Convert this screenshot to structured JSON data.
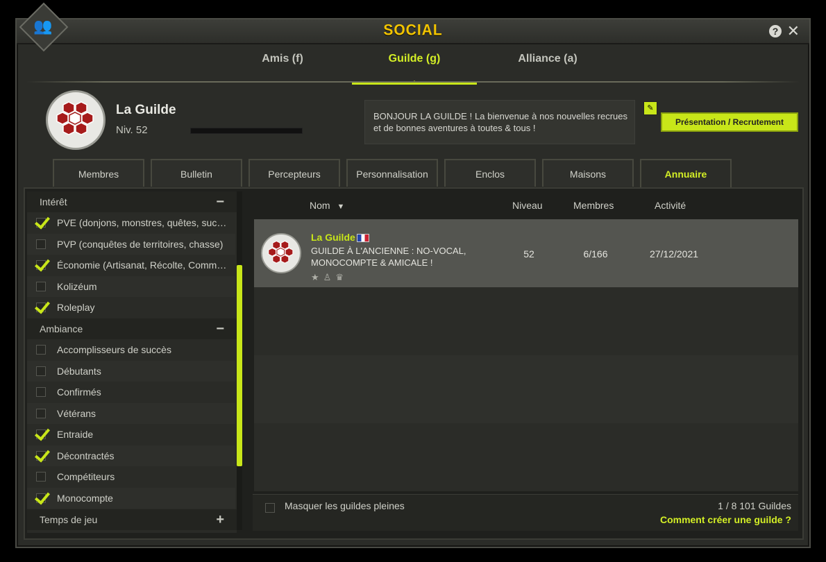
{
  "window": {
    "title": "SOCIAL"
  },
  "main_tabs": [
    {
      "label": "Amis (f)"
    },
    {
      "label": "Guilde (g)"
    },
    {
      "label": "Alliance (a)"
    }
  ],
  "guild": {
    "name": "La Guilde",
    "level": "Niv. 52",
    "motd": "BONJOUR LA GUILDE ! La bienvenue à nos nouvelles recrues et de bonnes aventures à toutes & tous !",
    "present_button": "Présentation / Recrutement"
  },
  "sub_tabs": [
    {
      "label": "Membres"
    },
    {
      "label": "Bulletin"
    },
    {
      "label": "Percepteurs"
    },
    {
      "label": "Personnalisation"
    },
    {
      "label": "Enclos"
    },
    {
      "label": "Maisons"
    },
    {
      "label": "Annuaire"
    }
  ],
  "filters": {
    "interest": {
      "title": "Intérêt",
      "toggle": "−",
      "items": [
        {
          "label": "PVE (donjons, monstres, quêtes, succès)",
          "checked": true
        },
        {
          "label": "PVP (conquêtes de territoires, chasse)",
          "checked": false
        },
        {
          "label": "Économie (Artisanat, Récolte, Commerce)",
          "checked": true
        },
        {
          "label": "Kolizéum",
          "checked": false
        },
        {
          "label": "Roleplay",
          "checked": true
        }
      ]
    },
    "ambiance": {
      "title": "Ambiance",
      "toggle": "−",
      "items": [
        {
          "label": "Accomplisseurs de succès",
          "checked": false
        },
        {
          "label": "Débutants",
          "checked": false
        },
        {
          "label": "Confirmés",
          "checked": false
        },
        {
          "label": "Vétérans",
          "checked": false
        },
        {
          "label": "Entraide",
          "checked": true
        },
        {
          "label": "Décontractés",
          "checked": true
        },
        {
          "label": "Compétiteurs",
          "checked": false
        },
        {
          "label": "Monocompte",
          "checked": true
        }
      ]
    },
    "playtime": {
      "title": "Temps de jeu",
      "toggle": "+"
    }
  },
  "list": {
    "columns": {
      "name": "Nom",
      "level": "Niveau",
      "members": "Membres",
      "activity": "Activité"
    },
    "rows": [
      {
        "name": "La Guilde",
        "description": "GUILDE À L'ANCIENNE : NO-VOCAL, MONOCOMPTE & AMICALE !",
        "level": "52",
        "members": "6/166",
        "activity": "27/12/2021"
      }
    ]
  },
  "footer": {
    "hide_full": "Masquer les guildes pleines",
    "count": "1 / 8 101 Guildes",
    "create_link": "Comment créer une guilde ?"
  },
  "colors": {
    "accent": "#c8e619",
    "title": "#f2c400"
  }
}
